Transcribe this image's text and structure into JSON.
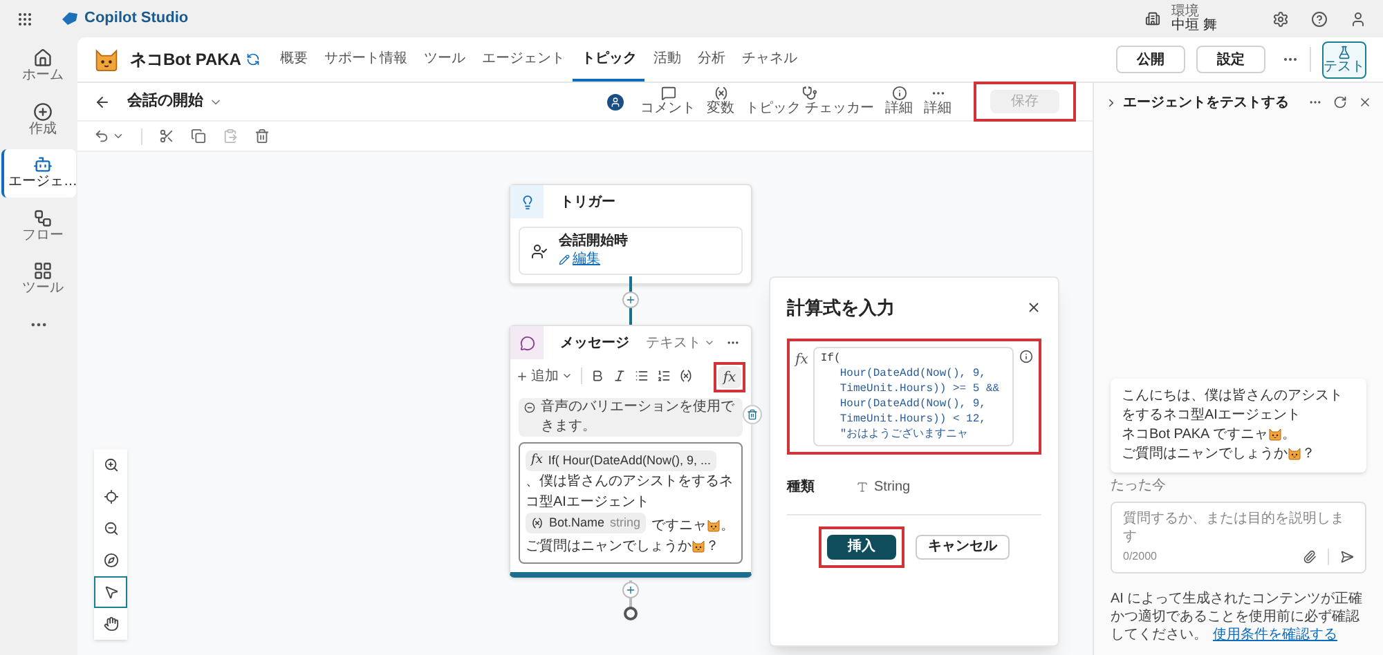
{
  "app_bar": {
    "product": "Copilot Studio",
    "environment_label": "環境",
    "environment_name": "中垣 舞"
  },
  "rail": [
    {
      "kind": "home",
      "label": "ホーム",
      "selected": false
    },
    {
      "kind": "create",
      "label": "作成",
      "selected": false
    },
    {
      "kind": "agent",
      "label": "エージェ…",
      "selected": true
    },
    {
      "kind": "flow",
      "label": "フロー",
      "selected": false
    },
    {
      "kind": "tools",
      "label": "ツール",
      "selected": false
    }
  ],
  "agent": {
    "name": "ネコBot PAKA"
  },
  "tabs": [
    {
      "label": "概要",
      "selected": false
    },
    {
      "label": "サポート情報",
      "selected": false
    },
    {
      "label": "ツール",
      "selected": false
    },
    {
      "label": "エージェント",
      "selected": false
    },
    {
      "label": "トピック",
      "selected": true
    },
    {
      "label": "活動",
      "selected": false
    },
    {
      "label": "分析",
      "selected": false
    },
    {
      "label": "チャネル",
      "selected": false
    }
  ],
  "header_buttons": [
    "公開",
    "設定"
  ],
  "test_button": {
    "label": "テスト",
    "selected": true
  },
  "topic": {
    "title": "会話の開始"
  },
  "topic_tools": [
    {
      "kind": "comment",
      "label": "コメント"
    },
    {
      "kind": "variable",
      "label": "変数"
    },
    {
      "kind": "checker",
      "label": "トピック チェッカー"
    },
    {
      "kind": "info",
      "label": "詳細"
    },
    {
      "kind": "more",
      "label": "詳細"
    }
  ],
  "save_button": {
    "label": "保存",
    "disabled": true,
    "highlighted": true
  },
  "trigger_node": {
    "title": "トリガー",
    "event": "会話開始時",
    "edit_link": "編集"
  },
  "message_node": {
    "title": "メッセージ",
    "mode": "テキスト",
    "add_label": "追加",
    "fx_button": {
      "label": "fx",
      "highlighted": true
    },
    "banner": "音声のバリエーションを使用できます。",
    "parts": [
      {
        "kind": "formula",
        "glyph": "fx",
        "text": "If( Hour(DateAdd(Now(), 9, ..."
      },
      {
        "kind": "paragraph",
        "text": "、僕は皆さんのアシストをするネコ型AIエージェント"
      },
      {
        "kind": "variable",
        "name": "Bot.Name",
        "type": "string"
      },
      {
        "kind": "text",
        "text": "ですニャ"
      },
      {
        "kind": "emoji"
      },
      {
        "kind": "text",
        "text": "。"
      },
      {
        "kind": "break"
      },
      {
        "kind": "text",
        "text": "ご質問はニャンでしょうか"
      },
      {
        "kind": "emoji"
      },
      {
        "kind": "text",
        "text": "？"
      }
    ]
  },
  "formula_panel": {
    "title": "計算式を入力",
    "fx_label": "fx",
    "highlighted": true,
    "code": [
      {
        "text": "If(",
        "children": [
          {
            "text": "Hour(DateAdd(Now(), 9,"
          },
          {
            "text": "TimeUnit.Hours)) >= 5 &&"
          },
          {
            "text": "Hour(DateAdd(Now(), 9,"
          },
          {
            "text": "TimeUnit.Hours)) < 12,"
          },
          {
            "text": "\"おはようございますニャ"
          }
        ]
      }
    ],
    "type_label": "種類",
    "type_value": "String",
    "insert_button": {
      "label": "挿入",
      "highlighted": true
    },
    "cancel_button": "キャンセル"
  },
  "zoom_tools": [
    {
      "kind": "zoom_in",
      "selected": false
    },
    {
      "kind": "center",
      "selected": false
    },
    {
      "kind": "zoom_out",
      "selected": false
    },
    {
      "kind": "minimap",
      "selected": false
    },
    {
      "kind": "select",
      "selected": true
    },
    {
      "kind": "pan",
      "selected": false
    }
  ],
  "test_panel": {
    "title": "エージェントをテストする",
    "bubble": [
      {
        "kind": "paragraph",
        "text": "こんにちは、僕は皆さんのアシストをするネコ型AIエージェント"
      },
      {
        "kind": "text",
        "text": "ネコBot PAKA ですニャ"
      },
      {
        "kind": "emoji"
      },
      {
        "kind": "text",
        "text": "。"
      },
      {
        "kind": "break"
      },
      {
        "kind": "text",
        "text": "ご質問はニャンでしょうか"
      },
      {
        "kind": "emoji"
      },
      {
        "kind": "text",
        "text": "？"
      }
    ],
    "timestamp": "たった今",
    "input": {
      "placeholder": "質問するか、または目的を説明します",
      "counter": "0/2000"
    },
    "disclaimer": "AI によって生成されたコンテンツが正確かつ適切であることを使用前に必ず確認してください。",
    "terms_link": "使用条件を確認する"
  }
}
